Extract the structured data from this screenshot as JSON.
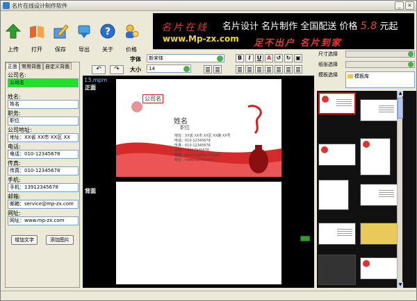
{
  "window": {
    "title": "名片在线设计制作软件"
  },
  "toolbar": [
    {
      "label": "上传",
      "icon": "upload-arrow-icon",
      "color": "#2f9e2f"
    },
    {
      "label": "打开",
      "icon": "open-book-icon",
      "color": "#d04a10"
    },
    {
      "label": "保存",
      "icon": "save-pencil-icon",
      "color": "#2a6bd0"
    },
    {
      "label": "导出",
      "icon": "export-hand-icon",
      "color": "#1f7fc8"
    },
    {
      "label": "关于",
      "icon": "help-question-icon",
      "color": "#1b64c8"
    },
    {
      "label": "价格",
      "icon": "price-person-icon",
      "color": "#e0a020"
    }
  ],
  "banner": {
    "brand": "名片在线",
    "headline": "名片设计 名片制作 全国配送 价格",
    "price": "5.8",
    "price_unit": "元起",
    "url": "www.Mp-zx.com",
    "slogan": "足不出户 名片到家"
  },
  "left_panel": {
    "tabs": [
      "正面",
      "常用背面",
      "自定义背面"
    ],
    "fields": [
      {
        "label": "公司名:",
        "value": "公司名",
        "highlight": true
      },
      {
        "label": "姓名:",
        "value": "姓名"
      },
      {
        "label": "职务:",
        "value": "职位"
      },
      {
        "label": "公司地址:",
        "value": "地址：XX省 XX市 XX区 XX"
      },
      {
        "label": "电话:",
        "value": "电话：010-12345678"
      },
      {
        "label": "传真:",
        "value": "传真：010-12345678"
      },
      {
        "label": "手机:",
        "value": "手机：13912345678"
      },
      {
        "label": "邮箱:",
        "value": "邮箱：service@mp-zx.com"
      },
      {
        "label": "网址:",
        "value": "网址：www.mp-zx.com"
      }
    ],
    "add_text_label": "增加文字",
    "add_image_label": "添加图片"
  },
  "font_bar": {
    "font_label": "字体",
    "font_value": "新宋体",
    "size_label": "大小",
    "size_value": "14",
    "bold": "B",
    "italic": "I",
    "underline": "U"
  },
  "canvas": {
    "file_tab": "13.mpm",
    "front_label": "正面",
    "back_label": "背面",
    "card": {
      "company": "公司名",
      "name": "姓名",
      "title": "职位",
      "info_lines": [
        "地址：XX省 XX市 XX区 XX路 XX号",
        "电话：010-12345678",
        "传真：010-12345678",
        "手机：13912345678",
        "邮箱：service@mp-zx.com",
        "网址：www.mp-zx.com"
      ]
    }
  },
  "right_panel": {
    "size_label": "尺寸选择",
    "paper_label": "纸张选择",
    "template_label": "模板选择",
    "template_root": "模板库"
  },
  "colors": {
    "accent_red": "#d02a2a",
    "highlight_green": "#22e02a",
    "banner_yellow": "#f2d62b"
  }
}
